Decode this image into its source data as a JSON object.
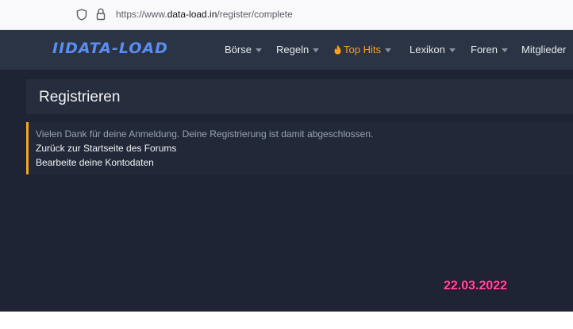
{
  "browser": {
    "url_prefix": "https://www.",
    "url_host": "data-load.in",
    "url_path": "/register/complete"
  },
  "site": {
    "logo": "IIDATA-LOAD",
    "brand_color": "#5a8df0",
    "nav": [
      {
        "label": "Börse",
        "icon": "caret-down-icon"
      },
      {
        "label": "Regeln",
        "icon": "caret-down-icon"
      },
      {
        "label": "Top Hits",
        "icon": "flame-icon",
        "color": "#ff9f1a"
      },
      {
        "label": "Lexikon",
        "icon": "caret-down-icon"
      },
      {
        "label": "Foren",
        "icon": "caret-down-icon"
      },
      {
        "label": "Mitglieder"
      }
    ]
  },
  "page": {
    "title": "Registrieren",
    "notice_message": "Vielen Dank für deine Anmeldung. Deine Registrierung ist damit abgeschlossen.",
    "link_forum_home": "Zurück zur Startseite des Forums",
    "link_account": "Bearbeite deine Kontodaten",
    "accent_color": "#f6a623"
  },
  "overlay": {
    "date": "22.03.2022",
    "color": "#ff4fa3"
  }
}
